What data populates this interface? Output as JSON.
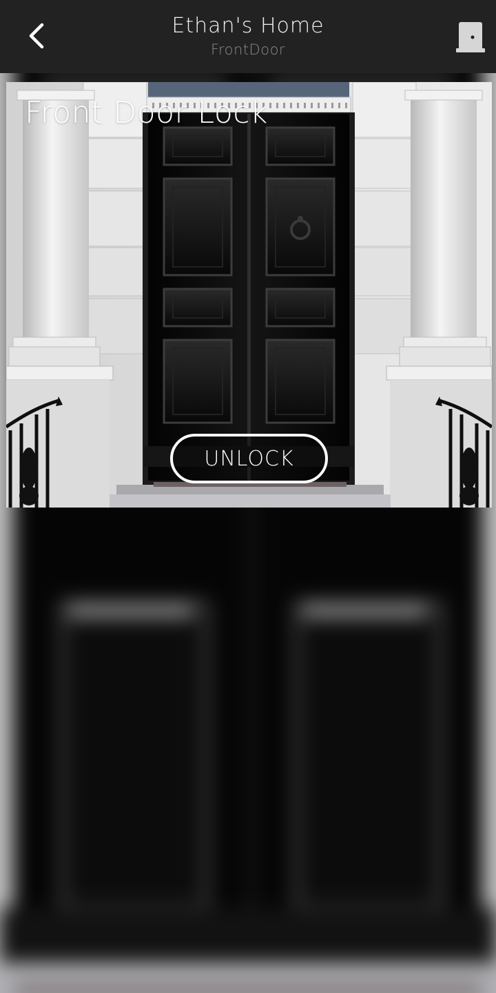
{
  "header": {
    "title": "Ethan's Home",
    "subtitle": "FrontDoor",
    "back_icon": "chevron-left-icon",
    "right_icon": "door-icon"
  },
  "card": {
    "title": "Front Door Lock",
    "action_label": "UNLOCK"
  },
  "colors": {
    "header_bg": "#222222",
    "title_text": "#f2f2f2",
    "subtitle_text": "#8b8b8b",
    "door_black": "#0a0a0a",
    "facade_white": "#e4e4e4"
  }
}
